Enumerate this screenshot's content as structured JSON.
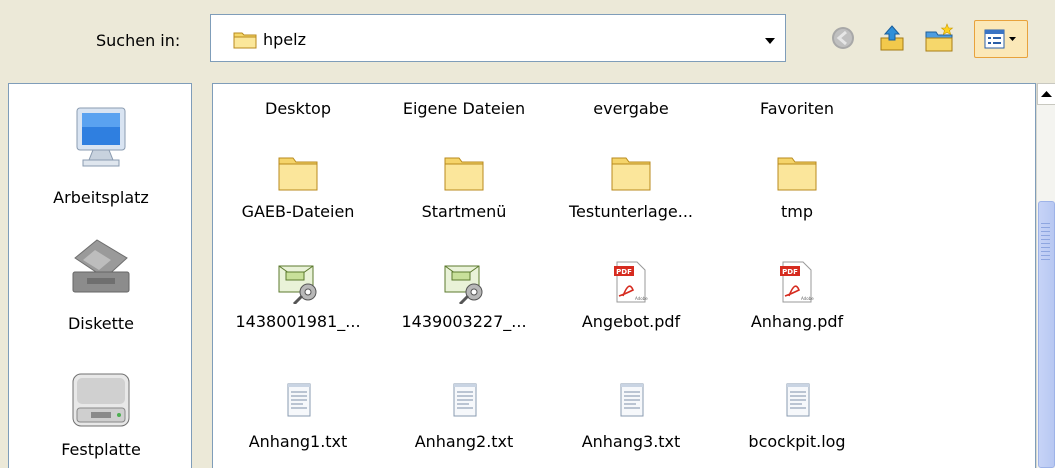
{
  "lookin": {
    "label": "Suchen in:",
    "value": "hpelz"
  },
  "toolbar": {
    "back_icon": "back-icon",
    "up_icon": "up-folder-icon",
    "newfolder_icon": "new-folder-icon",
    "view_icon": "view-menu-icon"
  },
  "places": [
    {
      "label": "Arbeitsplatz",
      "icon": "computer-icon"
    },
    {
      "label": "Diskette",
      "icon": "floppy-icon"
    },
    {
      "label": "Festplatte",
      "icon": "harddisk-icon"
    }
  ],
  "files": {
    "top_row": [
      "Desktop",
      "Eigene Dateien",
      "evergabe",
      "Favoriten"
    ],
    "rows": [
      [
        "GAEB-Dateien",
        "Startmenü",
        "Testunterlage...",
        "tmp"
      ],
      [
        "1438001981_...",
        "1439003227_...",
        "Angebot.pdf",
        "Anhang.pdf"
      ],
      [
        "Anhang1.txt",
        "Anhang2.txt",
        "Anhang3.txt",
        "bcockpit.log"
      ]
    ],
    "row_icons": [
      [
        "folder-icon",
        "folder-icon",
        "folder-icon",
        "folder-icon"
      ],
      [
        "certificate-key-icon",
        "certificate-key-icon",
        "pdf-icon",
        "pdf-icon"
      ],
      [
        "text-file-icon",
        "text-file-icon",
        "text-file-icon",
        "text-file-icon"
      ]
    ]
  }
}
